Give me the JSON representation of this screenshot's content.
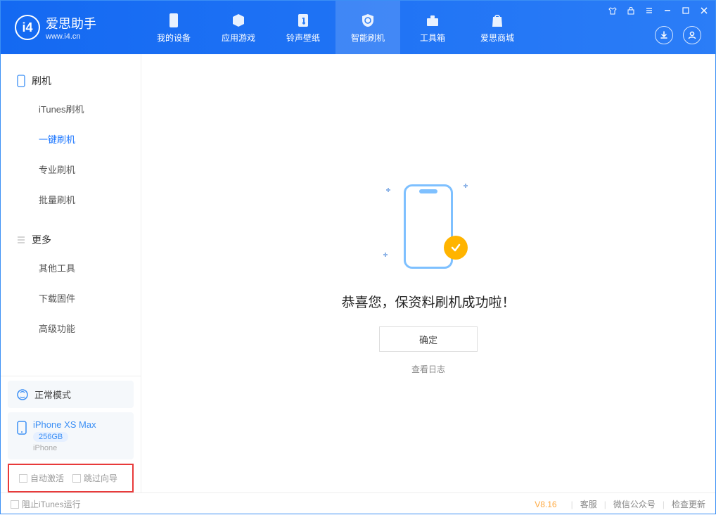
{
  "app": {
    "name": "爱思助手",
    "site": "www.i4.cn"
  },
  "tabs": [
    {
      "label": "我的设备"
    },
    {
      "label": "应用游戏"
    },
    {
      "label": "铃声壁纸"
    },
    {
      "label": "智能刷机"
    },
    {
      "label": "工具箱"
    },
    {
      "label": "爱思商城"
    }
  ],
  "sidebar": {
    "group1": {
      "title": "刷机",
      "items": [
        "iTunes刷机",
        "一键刷机",
        "专业刷机",
        "批量刷机"
      ]
    },
    "group2": {
      "title": "更多",
      "items": [
        "其他工具",
        "下载固件",
        "高级功能"
      ]
    }
  },
  "device": {
    "mode": "正常模式",
    "name": "iPhone XS Max",
    "storage": "256GB",
    "type": "iPhone"
  },
  "checkboxes": {
    "auto_activate": "自动激活",
    "skip_guide": "跳过向导"
  },
  "main": {
    "success_text": "恭喜您，保资料刷机成功啦！",
    "confirm": "确定",
    "view_log": "查看日志"
  },
  "footer": {
    "block_itunes": "阻止iTunes运行",
    "version": "V8.16",
    "support": "客服",
    "wechat": "微信公众号",
    "update": "检查更新"
  }
}
